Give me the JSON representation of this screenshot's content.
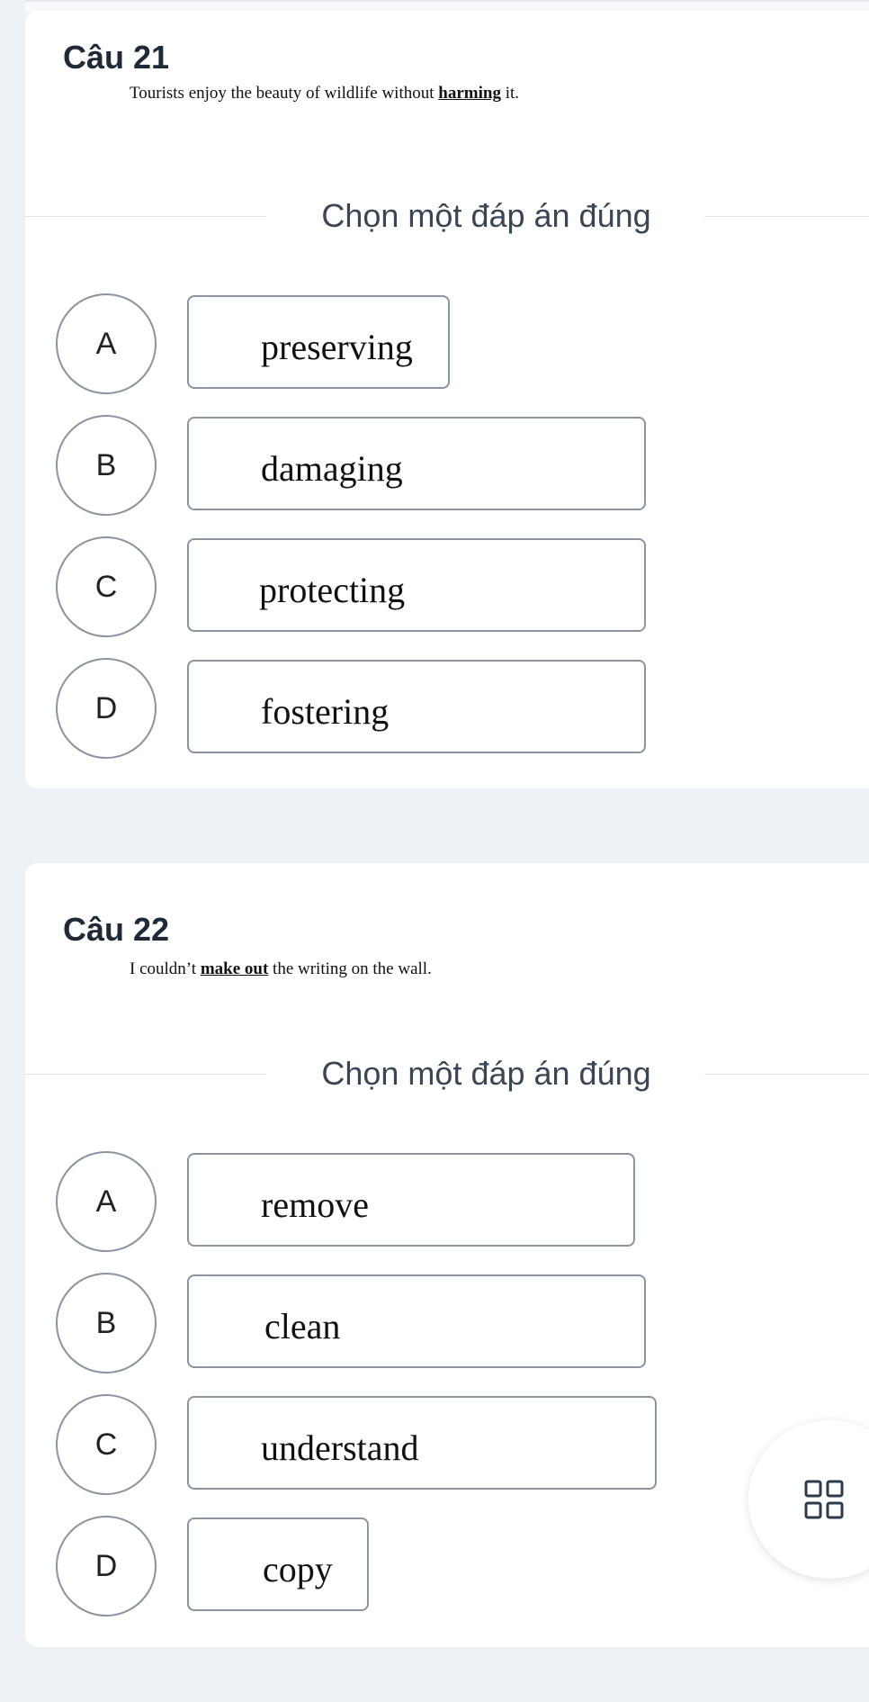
{
  "questions": [
    {
      "title": "Câu 21",
      "text": {
        "before": "Tourists enjoy the beauty of wildlife without ",
        "emphasis": "harming",
        "after": " it."
      },
      "instruction": "Chọn một đáp án đúng",
      "options": [
        {
          "letter": "A",
          "text": "preserving"
        },
        {
          "letter": "B",
          "text": "damaging"
        },
        {
          "letter": "C",
          "text": "protecting"
        },
        {
          "letter": "D",
          "text": "fostering"
        }
      ]
    },
    {
      "title": "Câu 22",
      "text": {
        "before": "I couldn’t ",
        "emphasis": "make out",
        "after": " the writing on the wall."
      },
      "instruction": "Chọn một đáp án đúng",
      "options": [
        {
          "letter": "A",
          "text": "remove"
        },
        {
          "letter": "B",
          "text": "clean"
        },
        {
          "letter": "C",
          "text": "understand"
        },
        {
          "letter": "D",
          "text": "copy"
        }
      ]
    }
  ],
  "fab": {
    "icon": "grid-icon"
  },
  "colors": {
    "page_bg": "#eef1f5",
    "card_bg": "#ffffff",
    "border": "#8a939e",
    "instruction_text": "#3b4654",
    "title_text": "#1f2937"
  }
}
